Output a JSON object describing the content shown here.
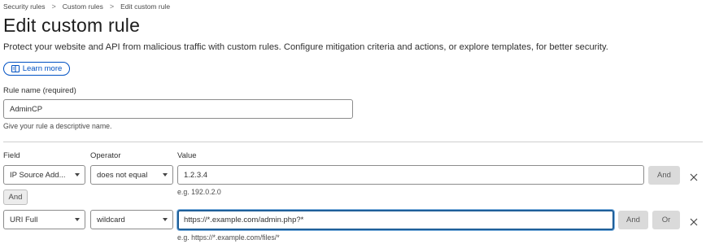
{
  "breadcrumb": {
    "items": [
      "Security rules",
      "Custom rules",
      "Edit custom rule"
    ],
    "separator": ">"
  },
  "header": {
    "title": "Edit custom rule",
    "subtitle": "Protect your website and API from malicious traffic with custom rules. Configure mitigation criteria and actions, or explore templates, for better security.",
    "learn_more": "Learn more"
  },
  "rule_name": {
    "label": "Rule name (required)",
    "value": "AdminCP",
    "help": "Give your rule a descriptive name."
  },
  "expression": {
    "headers": {
      "field": "Field",
      "operator": "Operator",
      "value": "Value"
    },
    "conditions": [
      {
        "field": "IP Source Add...",
        "operator": "does not equal",
        "value": "1.2.3.4",
        "hint": "e.g. 192.0.2.0",
        "and_label": "And"
      },
      {
        "field": "URI Full",
        "operator": "wildcard",
        "value": "https://*.example.com/admin.php?*",
        "hint": "e.g. https://*.example.com/files/*",
        "and_label": "And",
        "or_label": "Or"
      }
    ],
    "connector": "And"
  },
  "colors": {
    "accent": "#0051c3",
    "focus_border": "#1f5f99",
    "button_gray": "#dadada"
  },
  "icons": {
    "learn_more": "book-icon",
    "dropdown": "chevron-down-icon",
    "remove": "close-icon"
  }
}
